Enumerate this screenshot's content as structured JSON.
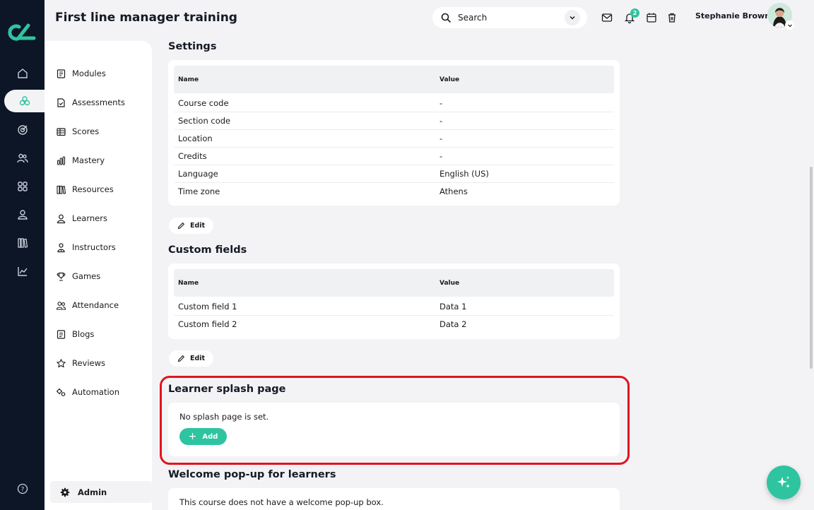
{
  "header": {
    "course_title": "First line manager training",
    "search_placeholder": "Search",
    "notification_count": "2",
    "user_name": "Stephanie Brown"
  },
  "rail": {
    "icons": [
      "home-icon",
      "courses-icon",
      "target-icon",
      "users-icon",
      "apps-icon",
      "profile-icon",
      "library-icon",
      "chart-icon",
      "help-icon"
    ],
    "active": "courses-icon"
  },
  "nav": {
    "items": [
      {
        "label": "Modules",
        "icon": "modules-icon"
      },
      {
        "label": "Assessments",
        "icon": "assessments-icon"
      },
      {
        "label": "Scores",
        "icon": "scores-icon"
      },
      {
        "label": "Mastery",
        "icon": "mastery-icon"
      },
      {
        "label": "Resources",
        "icon": "resources-icon"
      },
      {
        "label": "Learners",
        "icon": "learners-icon"
      },
      {
        "label": "Instructors",
        "icon": "instructors-icon"
      },
      {
        "label": "Games",
        "icon": "games-icon"
      },
      {
        "label": "Attendance",
        "icon": "attendance-icon"
      },
      {
        "label": "Blogs",
        "icon": "blogs-icon"
      },
      {
        "label": "Reviews",
        "icon": "reviews-icon"
      },
      {
        "label": "Automation",
        "icon": "automation-icon"
      }
    ],
    "admin_label": "Admin"
  },
  "settings": {
    "title": "Settings",
    "col_name": "Name",
    "col_value": "Value",
    "rows": [
      {
        "name": "Course code",
        "value": "-"
      },
      {
        "name": "Section code",
        "value": "-"
      },
      {
        "name": "Location",
        "value": "-"
      },
      {
        "name": "Credits",
        "value": "-"
      },
      {
        "name": "Language",
        "value": "English (US)"
      },
      {
        "name": "Time zone",
        "value": "Athens"
      }
    ],
    "edit_label": "Edit"
  },
  "custom_fields": {
    "title": "Custom fields",
    "col_name": "Name",
    "col_value": "Value",
    "rows": [
      {
        "name": "Custom field 1",
        "value": "Data 1"
      },
      {
        "name": "Custom field 2",
        "value": "Data 2"
      }
    ],
    "edit_label": "Edit"
  },
  "splash": {
    "title": "Learner splash page",
    "message": "No splash page is set.",
    "add_label": "Add"
  },
  "welcome": {
    "title": "Welcome pop-up for learners",
    "message": "This course does not have a welcome pop-up box."
  },
  "colors": {
    "accent": "#2ec4a0",
    "rail": "#0c1627",
    "highlight": "#e0141e"
  }
}
